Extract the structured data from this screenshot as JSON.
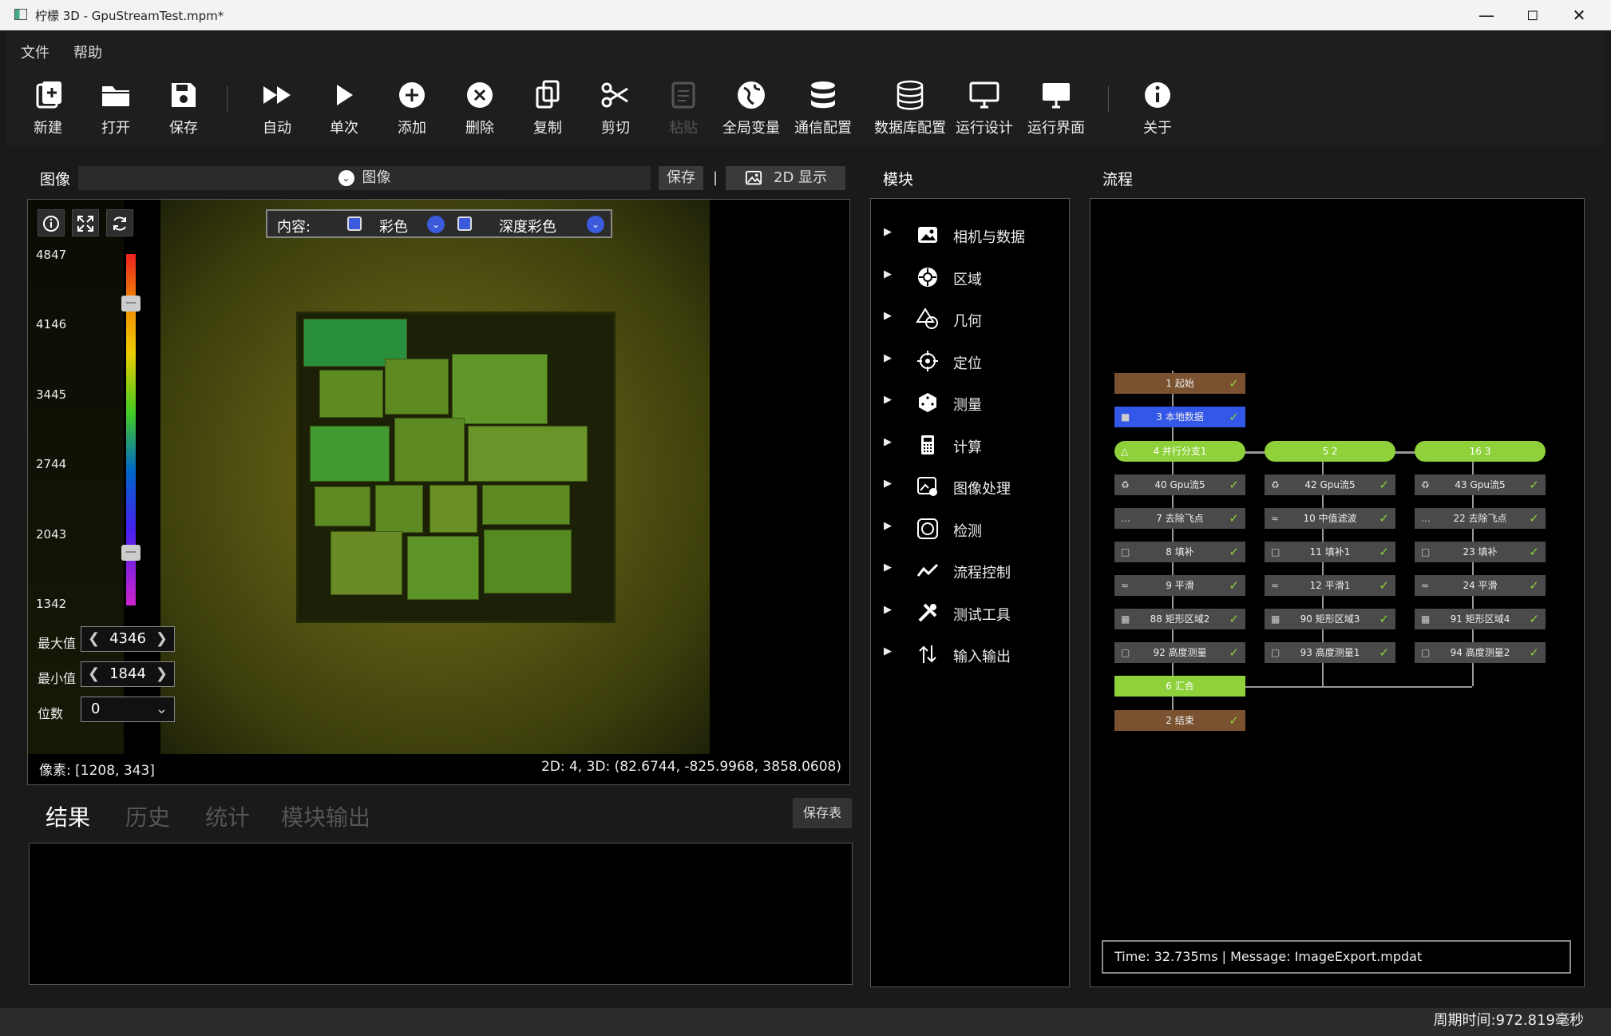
{
  "window": {
    "title": "柠檬 3D  - GpuStreamTest.mpm*"
  },
  "menu": [
    "文件",
    "帮助"
  ],
  "toolbar": [
    {
      "label": "新建",
      "icon": "new-file-icon"
    },
    {
      "label": "打开",
      "icon": "folder-icon"
    },
    {
      "label": "保存",
      "icon": "save-icon"
    },
    {
      "label": "自动",
      "icon": "fast-forward-icon"
    },
    {
      "label": "单次",
      "icon": "play-icon"
    },
    {
      "label": "添加",
      "icon": "plus-circle-icon"
    },
    {
      "label": "删除",
      "icon": "x-circle-icon"
    },
    {
      "label": "复制",
      "icon": "copy-icon"
    },
    {
      "label": "剪切",
      "icon": "scissors-icon"
    },
    {
      "label": "粘贴",
      "icon": "paste-icon",
      "disabled": true
    },
    {
      "label": "全局变量",
      "icon": "globe-icon"
    },
    {
      "label": "通信配置",
      "icon": "database-icon"
    },
    {
      "label": "数据库配置",
      "icon": "database-icon"
    },
    {
      "label": "运行设计",
      "icon": "monitor-icon"
    },
    {
      "label": "运行界面",
      "icon": "monitor-icon"
    },
    {
      "label": "关于",
      "icon": "info-icon"
    }
  ],
  "image_panel": {
    "title": "图像",
    "selector": "图像",
    "save": "保存",
    "separator": "|",
    "display": "2D 显示",
    "content_label": "内容:",
    "content_color": "彩色",
    "content_depth": "深度彩色",
    "scale": [
      "4847",
      "4146",
      "3445",
      "2744",
      "2043",
      "1342"
    ],
    "max_label": "最大值",
    "max_value": "4346",
    "min_label": "最小值",
    "min_value": "1844",
    "digits_label": "位数",
    "digits_value": "0",
    "pixel": "像素: [1208, 343]",
    "coords": "2D: 4, 3D: (82.6744, -825.9968, 3858.0608)"
  },
  "tabs": [
    "结果",
    "历史",
    "统计",
    "模块输出"
  ],
  "save_table": "保存表",
  "modules_panel": {
    "title": "模块",
    "items": [
      {
        "label": "相机与数据",
        "icon": "camera-image-icon"
      },
      {
        "label": "区域",
        "icon": "region-icon"
      },
      {
        "label": "几何",
        "icon": "geometry-icon"
      },
      {
        "label": "定位",
        "icon": "crosshair-icon"
      },
      {
        "label": "测量",
        "icon": "dice-icon"
      },
      {
        "label": "计算",
        "icon": "calculator-icon"
      },
      {
        "label": "图像处理",
        "icon": "image-process-icon"
      },
      {
        "label": "检测",
        "icon": "detect-icon"
      },
      {
        "label": "流程控制",
        "icon": "flow-line-icon"
      },
      {
        "label": "测试工具",
        "icon": "tools-icon"
      },
      {
        "label": "输入输出",
        "icon": "io-arrows-icon"
      }
    ]
  },
  "flow_panel": {
    "title": "流程",
    "nodes": {
      "start": "1 起始",
      "local": "3 本地数据",
      "branch": "4 并行分支1",
      "b2": "5 2",
      "b3": "16 3",
      "c1": [
        "40 Gpu流5",
        "7 去除飞点",
        "8 填补",
        "9 平滑",
        "88 矩形区域2",
        "92 高度测量"
      ],
      "c2": [
        "42 Gpu流5",
        "10 中值滤波",
        "11 填补1",
        "12 平滑1",
        "90 矩形区域3",
        "93 高度测量1"
      ],
      "c3": [
        "43 Gpu流5",
        "22 去除飞点",
        "23 填补",
        "24 平滑",
        "91 矩形区域4",
        "94 高度测量2"
      ],
      "merge": "6 汇合",
      "end": "2 结束"
    },
    "status": "Time: 32.735ms  |   Message: ImageExport.mpdat"
  },
  "cycle_time": "周期时间:972.819毫秒",
  "colors": {
    "accent_green": "#8ed13a",
    "node_brown": "#7a5230",
    "node_blue": "#3357e6"
  }
}
